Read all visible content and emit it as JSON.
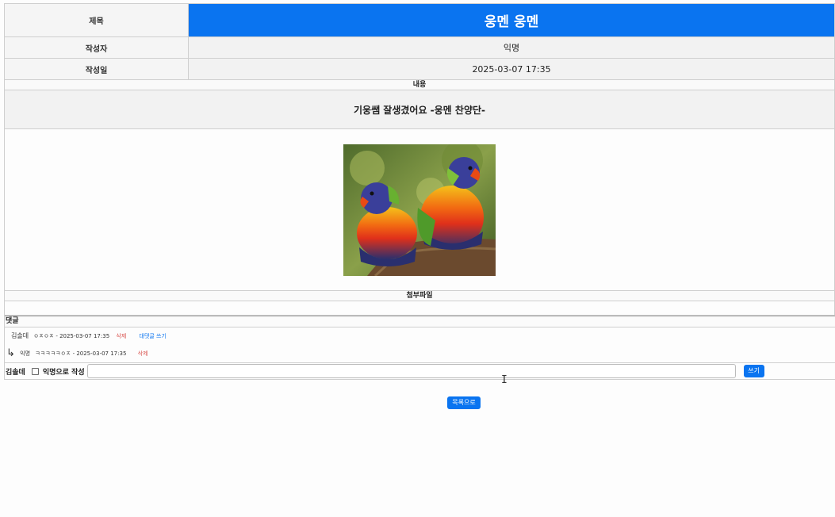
{
  "post": {
    "title_label": "제목",
    "title": "웅멘 웅멘",
    "author_label": "작성자",
    "author": "익명",
    "date_label": "작성일",
    "date": "2025-03-07 17:35",
    "content_label": "내용",
    "content": "기웅쌤 잘생겼어요 -웅멘 찬양단-",
    "attachment_label": "첨부파일"
  },
  "comments": {
    "header": "댓글",
    "items": [
      {
        "author": "김솔데",
        "text": "ㅇㅈㅇㅈ - 2025-03-07 17:35",
        "delete": "삭제",
        "reply": "대댓글 쓰기"
      }
    ],
    "replies": [
      {
        "author": "익명",
        "text": "ㅋㅋㅋㅋㅋㅇㅈ - 2025-03-07 17:35",
        "delete": "삭제"
      }
    ]
  },
  "write": {
    "user": "김솔데",
    "anonymous_label": "익명으로 작성",
    "submit_label": "쓰기"
  },
  "list_button": "목록으로",
  "colors": {
    "accent": "#0a74f0",
    "delete": "#d9534f"
  }
}
